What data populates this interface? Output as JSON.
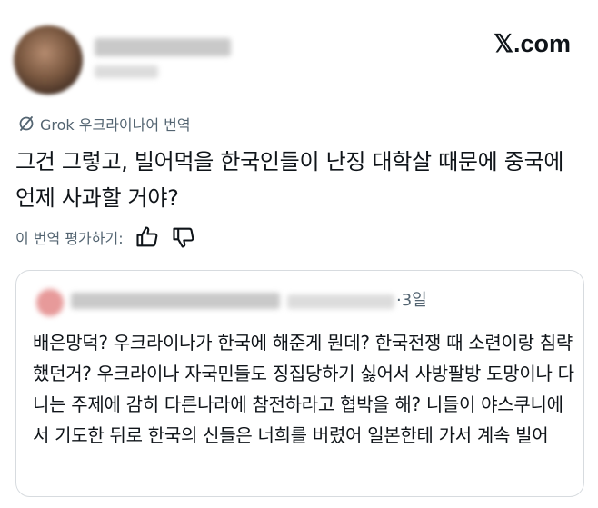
{
  "header": {
    "brand": "𝕏.com"
  },
  "post": {
    "translate_label": "Grok 우크라이나어 번역",
    "text": "그건 그렇고, 빌어먹을 한국인들이 난징 대학살 때문에 중국에 언제 사과할 거야?",
    "rate_label": "이 번역 평가하기:"
  },
  "quote": {
    "date": "·3일",
    "text": "배은망덕? 우크라이나가 한국에 해준게 뭔데? 한국전쟁 때 소련이랑 침략했던거? 우크라이나 자국민들도 징집당하기 싫어서 사방팔방 도망이나 다니는 주제에 감히 다른나라에 참전하라고 협박을 해? 니들이 야스쿠니에서 기도한 뒤로 한국의 신들은 너희를 버렸어 일본한테 가서 계속 빌어"
  },
  "colors": {
    "text": "#0f1419",
    "secondary": "#536471",
    "border": "#d7dbdf"
  }
}
